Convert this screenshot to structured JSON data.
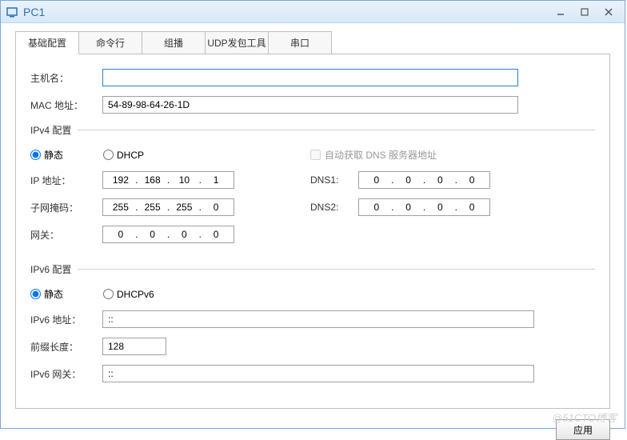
{
  "window": {
    "title": "PC1"
  },
  "tabs": [
    "基础配置",
    "命令行",
    "组播",
    "UDP发包工具",
    "串口"
  ],
  "basic": {
    "host_label": "主机名：",
    "host_value": "",
    "mac_label": "MAC 地址：",
    "mac_value": "54-89-98-64-26-1D"
  },
  "ipv4": {
    "legend": "IPv4 配置",
    "static_label": "静态",
    "dhcp_label": "DHCP",
    "auto_dns_label": "自动获取 DNS 服务器地址",
    "ip_label": "IP 地址：",
    "ip": [
      "192",
      "168",
      "10",
      "1"
    ],
    "mask_label": "子网掩码：",
    "mask": [
      "255",
      "255",
      "255",
      "0"
    ],
    "gw_label": "网关：",
    "gw": [
      "0",
      "0",
      "0",
      "0"
    ],
    "dns1_label": "DNS1:",
    "dns1": [
      "0",
      "0",
      "0",
      "0"
    ],
    "dns2_label": "DNS2:",
    "dns2": [
      "0",
      "0",
      "0",
      "0"
    ]
  },
  "ipv6": {
    "legend": "IPv6 配置",
    "static_label": "静态",
    "dhcp_label": "DHCPv6",
    "addr_label": "IPv6 地址：",
    "addr_value": "::",
    "prefix_label": "前缀长度：",
    "prefix_value": "128",
    "gw_label": "IPv6 网关：",
    "gw_value": "::"
  },
  "footer": {
    "apply": "应用"
  },
  "watermark": "@51CTO博客"
}
